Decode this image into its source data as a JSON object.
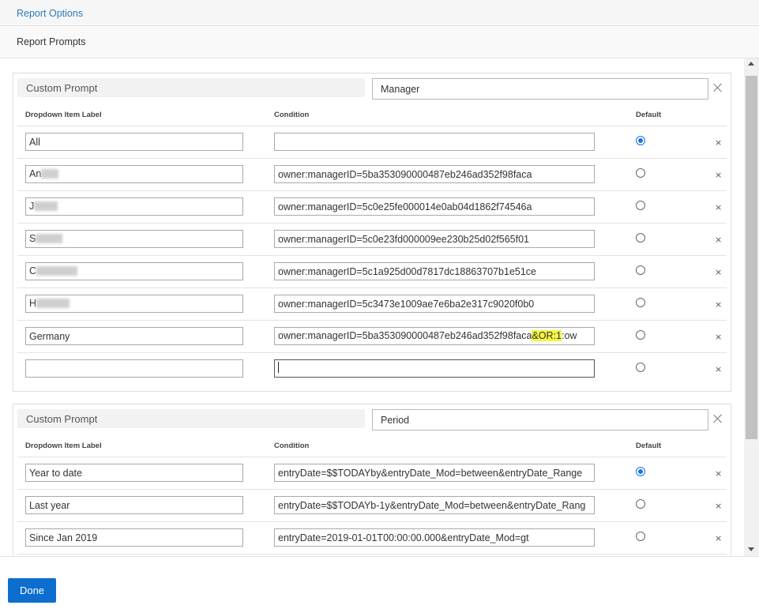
{
  "header": {
    "report_options_label": "Report Options"
  },
  "subheader": {
    "title": "Report Prompts"
  },
  "prompts": [
    {
      "header_label": "Custom Prompt",
      "name": "Manager",
      "columns": {
        "label": "Dropdown Item Label",
        "condition": "Condition",
        "default": "Default"
      },
      "rows": [
        {
          "label": "All",
          "condition": "",
          "default": true
        },
        {
          "label": "An",
          "condition": "owner:managerID=5ba353090000487eb246ad352f98faca",
          "default": false
        },
        {
          "label": "J",
          "condition": "owner:managerID=5c0e25fe000014e0ab04d1862f74546a",
          "default": false
        },
        {
          "label": "S",
          "condition": "owner:managerID=5c0e23fd000009ee230b25d02f565f01",
          "default": false
        },
        {
          "label": "C",
          "condition": "owner:managerID=5c1a925d00d7817dc18863707b1e51ce",
          "default": false
        },
        {
          "label": "H",
          "condition": "owner:managerID=5c3473e1009ae7e6ba2e317c9020f0b0",
          "default": false
        },
        {
          "label": "Germany",
          "condition_prefix": "owner:managerID=5ba353090000487eb246ad352f98faca",
          "condition_highlight": "&OR:1",
          "condition_suffix": ":ow",
          "default": false
        },
        {
          "label": "",
          "condition": "",
          "default": false
        }
      ]
    },
    {
      "header_label": "Custom Prompt",
      "name": "Period",
      "columns": {
        "label": "Dropdown Item Label",
        "condition": "Condition",
        "default": "Default"
      },
      "rows": [
        {
          "label": "Year to date",
          "condition": "entryDate=$$TODAYby&entryDate_Mod=between&entryDate_Range",
          "default": true
        },
        {
          "label": "Last year",
          "condition": "entryDate=$$TODAYb-1y&entryDate_Mod=between&entryDate_Rang",
          "default": false
        },
        {
          "label": "Since Jan 2019",
          "condition": "entryDate=2019-01-01T00:00:00.000&entryDate_Mod=gt",
          "default": false
        }
      ]
    }
  ],
  "delete_glyph": "×",
  "footer": {
    "done_label": "Done"
  },
  "colors": {
    "link": "#2b7bbd",
    "primary_button": "#0d6ecf",
    "radio_selected": "#1a73e8",
    "highlight": "#f5f542"
  }
}
